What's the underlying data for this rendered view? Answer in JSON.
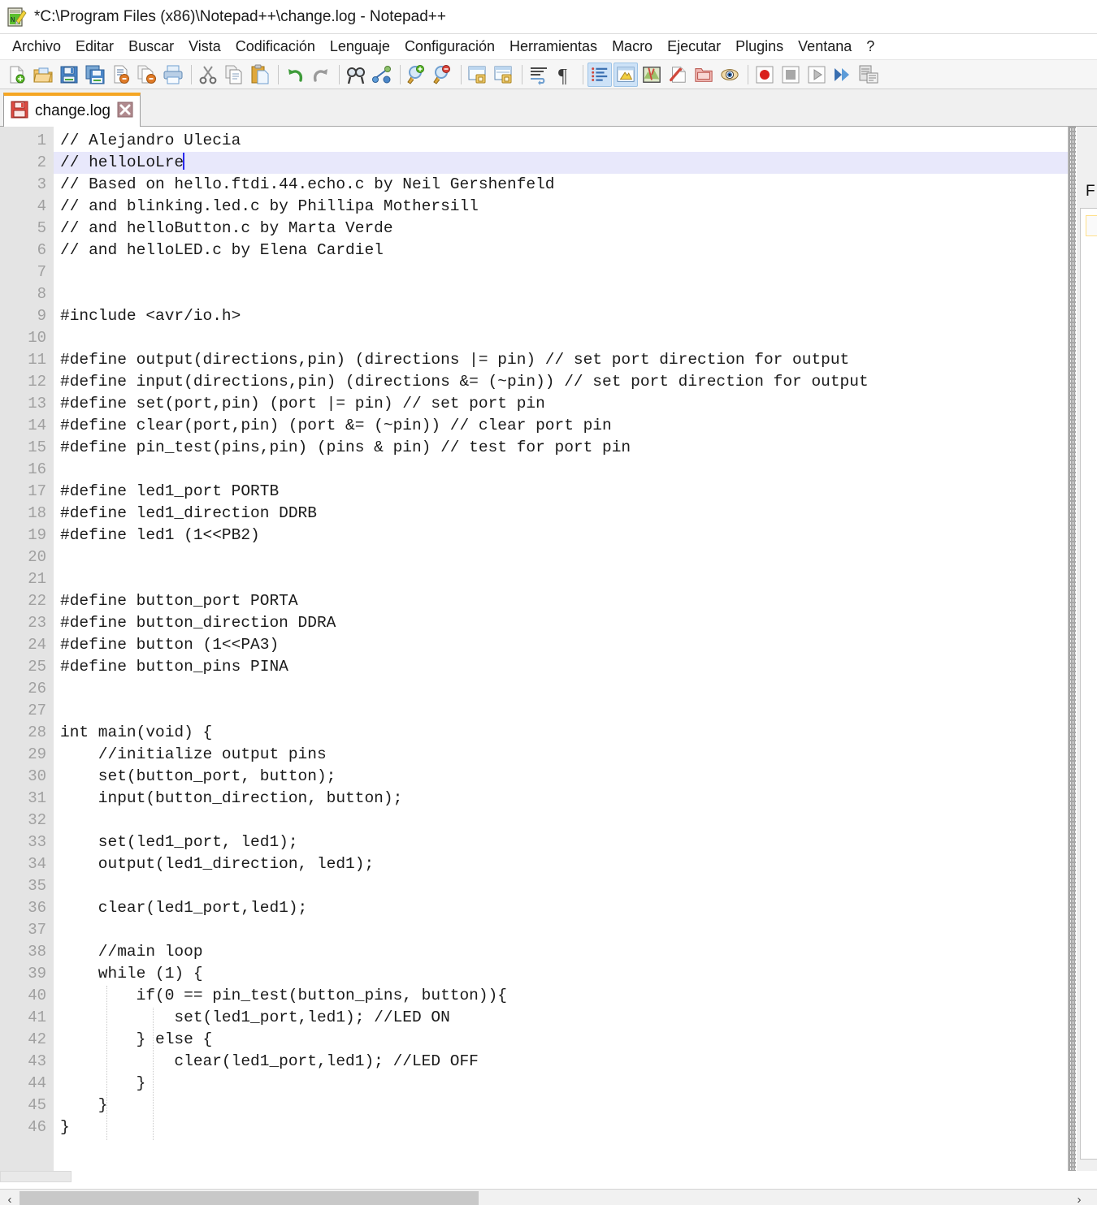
{
  "window": {
    "title": "*C:\\Program Files (x86)\\Notepad++\\change.log - Notepad++",
    "app_icon": "notepad-plus-plus-icon"
  },
  "menubar": {
    "items": [
      "Archivo",
      "Editar",
      "Buscar",
      "Vista",
      "Codificación",
      "Lenguaje",
      "Configuración",
      "Herramientas",
      "Macro",
      "Ejecutar",
      "Plugins",
      "Ventana",
      "?"
    ]
  },
  "toolbar": {
    "groups": [
      [
        "new-file-icon",
        "open-file-icon",
        "save-icon",
        "save-all-icon",
        "close-file-icon",
        "close-all-icon",
        "print-icon"
      ],
      [
        "cut-icon",
        "copy-icon",
        "paste-icon"
      ],
      [
        "undo-icon",
        "redo-icon"
      ],
      [
        "find-icon",
        "replace-icon"
      ],
      [
        "zoom-in-icon",
        "zoom-out-icon"
      ],
      [
        "sync-vertical-scroll-icon",
        "sync-horizontal-scroll-icon"
      ],
      [
        "word-wrap-icon",
        "show-all-characters-icon"
      ],
      [
        "show-indent-guide-icon",
        "user-defined-language-icon",
        "show-document-map-icon",
        "function-list-icon",
        "folder-as-workspace-icon",
        "document-switcher-icon"
      ],
      [
        "record-macro-icon",
        "stop-recording-icon",
        "playback-macro-icon",
        "run-macro-multiple-times-icon",
        "save-current-macro-icon"
      ]
    ],
    "active_buttons": [
      "show-indent-guide-icon",
      "user-defined-language-icon"
    ]
  },
  "tabs": [
    {
      "label": "change.log",
      "icon": "save-red-icon",
      "close_icon": "close-icon",
      "active": true,
      "modified": true
    }
  ],
  "editor": {
    "current_line": 2,
    "caret_line": 2,
    "lines": [
      {
        "n": 1,
        "text": "// Alejandro Ulecia"
      },
      {
        "n": 2,
        "text": "// helloLoLre"
      },
      {
        "n": 3,
        "text": "// Based on hello.ftdi.44.echo.c by Neil Gershenfeld"
      },
      {
        "n": 4,
        "text": "// and blinking.led.c by Phillipa Mothersill"
      },
      {
        "n": 5,
        "text": "// and helloButton.c by Marta Verde"
      },
      {
        "n": 6,
        "text": "// and helloLED.c by Elena Cardiel"
      },
      {
        "n": 7,
        "text": ""
      },
      {
        "n": 8,
        "text": ""
      },
      {
        "n": 9,
        "text": "#include <avr/io.h>"
      },
      {
        "n": 10,
        "text": ""
      },
      {
        "n": 11,
        "text": "#define output(directions,pin) (directions |= pin) // set port direction for output"
      },
      {
        "n": 12,
        "text": "#define input(directions,pin) (directions &= (~pin)) // set port direction for output"
      },
      {
        "n": 13,
        "text": "#define set(port,pin) (port |= pin) // set port pin"
      },
      {
        "n": 14,
        "text": "#define clear(port,pin) (port &= (~pin)) // clear port pin"
      },
      {
        "n": 15,
        "text": "#define pin_test(pins,pin) (pins & pin) // test for port pin"
      },
      {
        "n": 16,
        "text": ""
      },
      {
        "n": 17,
        "text": "#define led1_port PORTB"
      },
      {
        "n": 18,
        "text": "#define led1_direction DDRB"
      },
      {
        "n": 19,
        "text": "#define led1 (1<<PB2)"
      },
      {
        "n": 20,
        "text": ""
      },
      {
        "n": 21,
        "text": ""
      },
      {
        "n": 22,
        "text": "#define button_port PORTA"
      },
      {
        "n": 23,
        "text": "#define button_direction DDRA"
      },
      {
        "n": 24,
        "text": "#define button (1<<PA3)"
      },
      {
        "n": 25,
        "text": "#define button_pins PINA"
      },
      {
        "n": 26,
        "text": ""
      },
      {
        "n": 27,
        "text": ""
      },
      {
        "n": 28,
        "text": "int main(void) {"
      },
      {
        "n": 29,
        "text": "    //initialize output pins"
      },
      {
        "n": 30,
        "text": "    set(button_port, button);"
      },
      {
        "n": 31,
        "text": "    input(button_direction, button);"
      },
      {
        "n": 32,
        "text": ""
      },
      {
        "n": 33,
        "text": "    set(led1_port, led1);"
      },
      {
        "n": 34,
        "text": "    output(led1_direction, led1);"
      },
      {
        "n": 35,
        "text": ""
      },
      {
        "n": 36,
        "text": "    clear(led1_port,led1);"
      },
      {
        "n": 37,
        "text": ""
      },
      {
        "n": 38,
        "text": "    //main loop"
      },
      {
        "n": 39,
        "text": "    while (1) {"
      },
      {
        "n": 40,
        "text": "        if(0 == pin_test(button_pins, button)){"
      },
      {
        "n": 41,
        "text": "            set(led1_port,led1); //LED ON"
      },
      {
        "n": 42,
        "text": "        } else {"
      },
      {
        "n": 43,
        "text": "            clear(led1_port,led1); //LED OFF"
      },
      {
        "n": 44,
        "text": "        }"
      },
      {
        "n": 45,
        "text": "    }"
      },
      {
        "n": 46,
        "text": "}"
      }
    ]
  },
  "dock_panel": {
    "title": "F",
    "name": "function-list-panel"
  },
  "scrollbar": {
    "left_arrow": "‹",
    "right_arrow": "›"
  },
  "colors": {
    "tab_accent": "#f5a623",
    "current_line": "#e8e8fb",
    "gutter_bg": "#e4e4e4",
    "caret": "#2a2aee"
  }
}
